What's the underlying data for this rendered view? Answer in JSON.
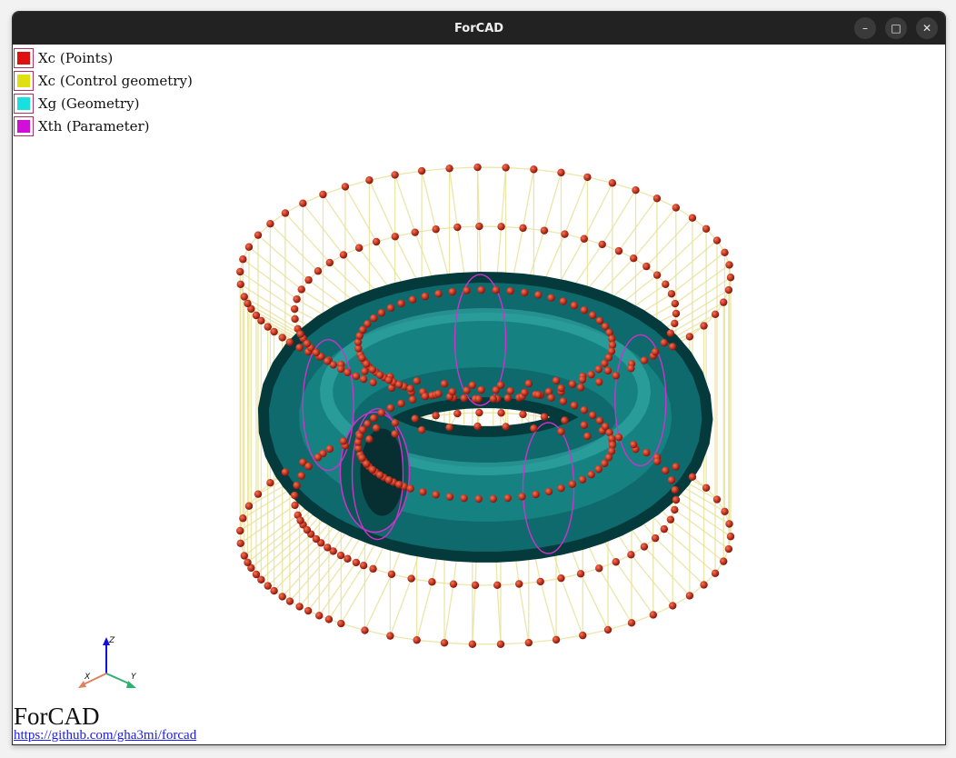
{
  "window": {
    "title": "ForCAD",
    "controls": {
      "minimize": "–",
      "maximize": "□",
      "close": "✕"
    }
  },
  "legend": [
    {
      "label": "Xc (Points)",
      "color": "#e11010"
    },
    {
      "label": "Xc (Control geometry)",
      "color": "#e0e010"
    },
    {
      "label": "Xg (Geometry)",
      "color": "#18e0e0"
    },
    {
      "label": "Xth (Parameter)",
      "color": "#d010d8"
    }
  ],
  "axes": {
    "z": "Z",
    "x": "X",
    "y": "Y"
  },
  "colors": {
    "surface": "#0e5f63",
    "surface_light": "#2aa0a0",
    "control_lines": "#e8e29a",
    "points": "#c81e10",
    "parameter": "#cc33cc"
  },
  "footer": {
    "brand": "ForCAD",
    "link": "https://github.com/gha3mi/forcad"
  }
}
